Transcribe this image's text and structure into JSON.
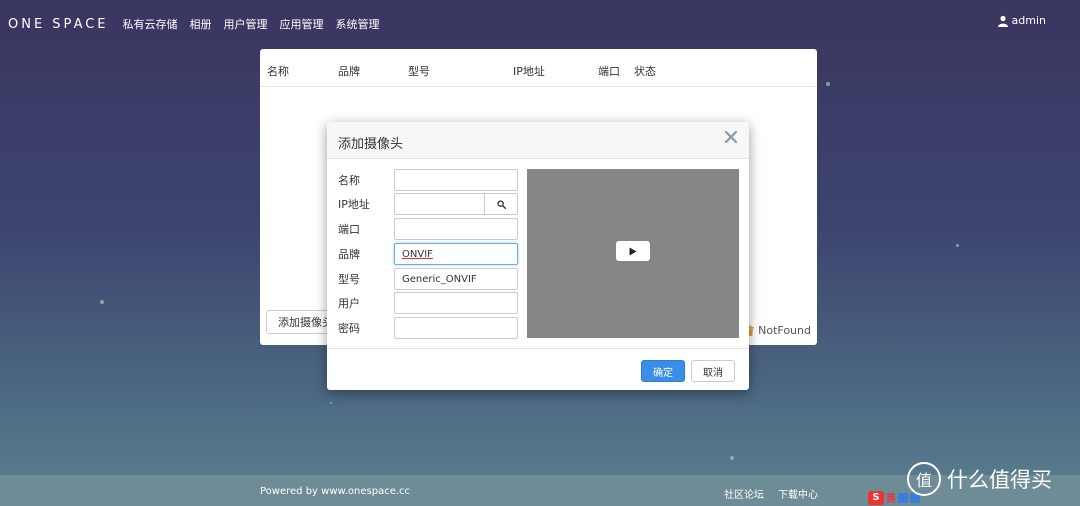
{
  "topbar": {
    "brand": "ONE SPACE",
    "nav": [
      "私有云存储",
      "相册",
      "用户管理",
      "应用管理",
      "系统管理"
    ],
    "user": "admin"
  },
  "table": {
    "columns": [
      "名称",
      "品牌",
      "型号",
      "IP地址",
      "端口",
      "状态"
    ]
  },
  "panel": {
    "add_button": "添加摄像头",
    "notfound": "NotFound"
  },
  "modal": {
    "title": "添加摄像头",
    "fields": [
      {
        "label": "名称",
        "value": ""
      },
      {
        "label": "IP地址",
        "value": ""
      },
      {
        "label": "端口",
        "value": ""
      },
      {
        "label": "品牌",
        "value": "ONVIF"
      },
      {
        "label": "型号",
        "value": "Generic_ONVIF"
      },
      {
        "label": "用户",
        "value": ""
      },
      {
        "label": "密码",
        "value": ""
      }
    ],
    "ok": "确定",
    "cancel": "取消"
  },
  "footer": {
    "powered": "Powered by www.onespace.cc",
    "links": [
      "社区论坛",
      "下载中心"
    ]
  },
  "ime": {
    "label": "英"
  },
  "watermark": {
    "text": "什么值得买",
    "icon": "值"
  },
  "colors": {
    "accent": "#3a8ee6",
    "video_bg": "#868686"
  }
}
